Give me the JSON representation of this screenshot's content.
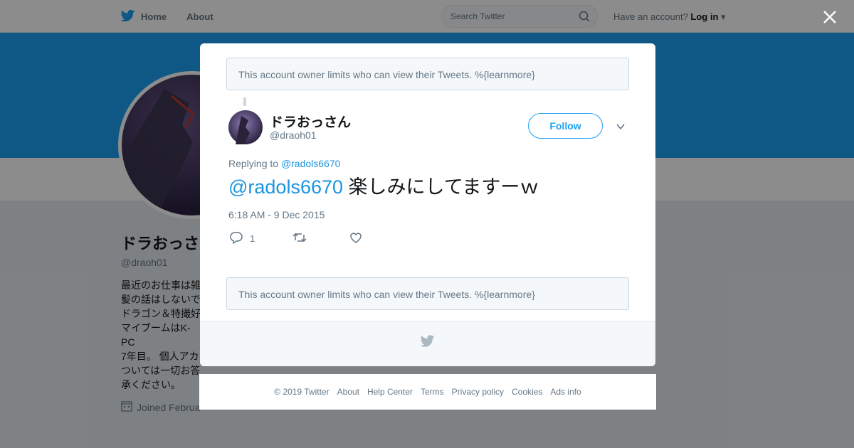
{
  "topbar": {
    "home_label": "Home",
    "about_label": "About",
    "search_placeholder": "Search Twitter",
    "have_account": "Have an account?",
    "login_label": "Log in"
  },
  "profile": {
    "name": "ドラおっさ",
    "handle": "@draoh01",
    "bio": "最近のお仕事は雑\n髪の話はしないで\nドラゴン＆特撮好\nマイブームはK-PC\n7年目。 個人アカ\nついては一切お答\n承ください。",
    "joined": "Joined Februa"
  },
  "notice_text": "This account owner limits who can view their Tweets. %{learnmore}",
  "tweet": {
    "name": "ドラおっさん",
    "handle": "@draoh01",
    "follow_label": "Follow",
    "replying_prefix": "Replying to",
    "replying_to": "@radols6670",
    "mention": "@radols6670",
    "text": "楽しみにしてますーｗ",
    "timestamp": "6:18 AM - 9 Dec 2015",
    "reply_count": "1"
  },
  "footer": {
    "links": [
      "© 2019 Twitter",
      "About",
      "Help Center",
      "Terms",
      "Privacy policy",
      "Cookies",
      "Ads info"
    ]
  },
  "colors": {
    "accent": "#1da1f2",
    "link": "#1b95e0",
    "muted": "#657786"
  }
}
